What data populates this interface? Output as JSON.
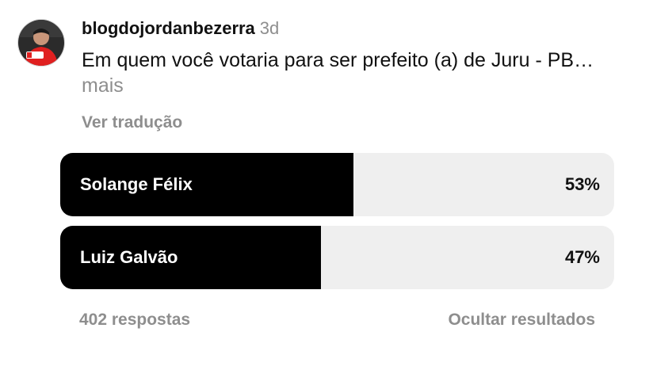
{
  "post": {
    "username": "blogdojordanbezerra",
    "time": "3d",
    "caption": "Em quem você votaria para ser prefeito (a) de Juru - PB…",
    "more_label": "mais",
    "translate_label": "Ver tradução"
  },
  "poll": {
    "options": [
      {
        "label": "Solange Félix",
        "percent_text": "53%",
        "fraction": 0.53
      },
      {
        "label": "Luiz Galvão",
        "percent_text": "47%",
        "fraction": 0.47
      }
    ],
    "responses_label": "402 respostas",
    "hide_label": "Ocultar resultados"
  },
  "colors": {
    "fill": "#000000",
    "track": "#efefef",
    "secondary_text": "#8e8e8e",
    "avatar_badge": "#e02020"
  },
  "icons": {
    "avatar": "profile-avatar"
  }
}
